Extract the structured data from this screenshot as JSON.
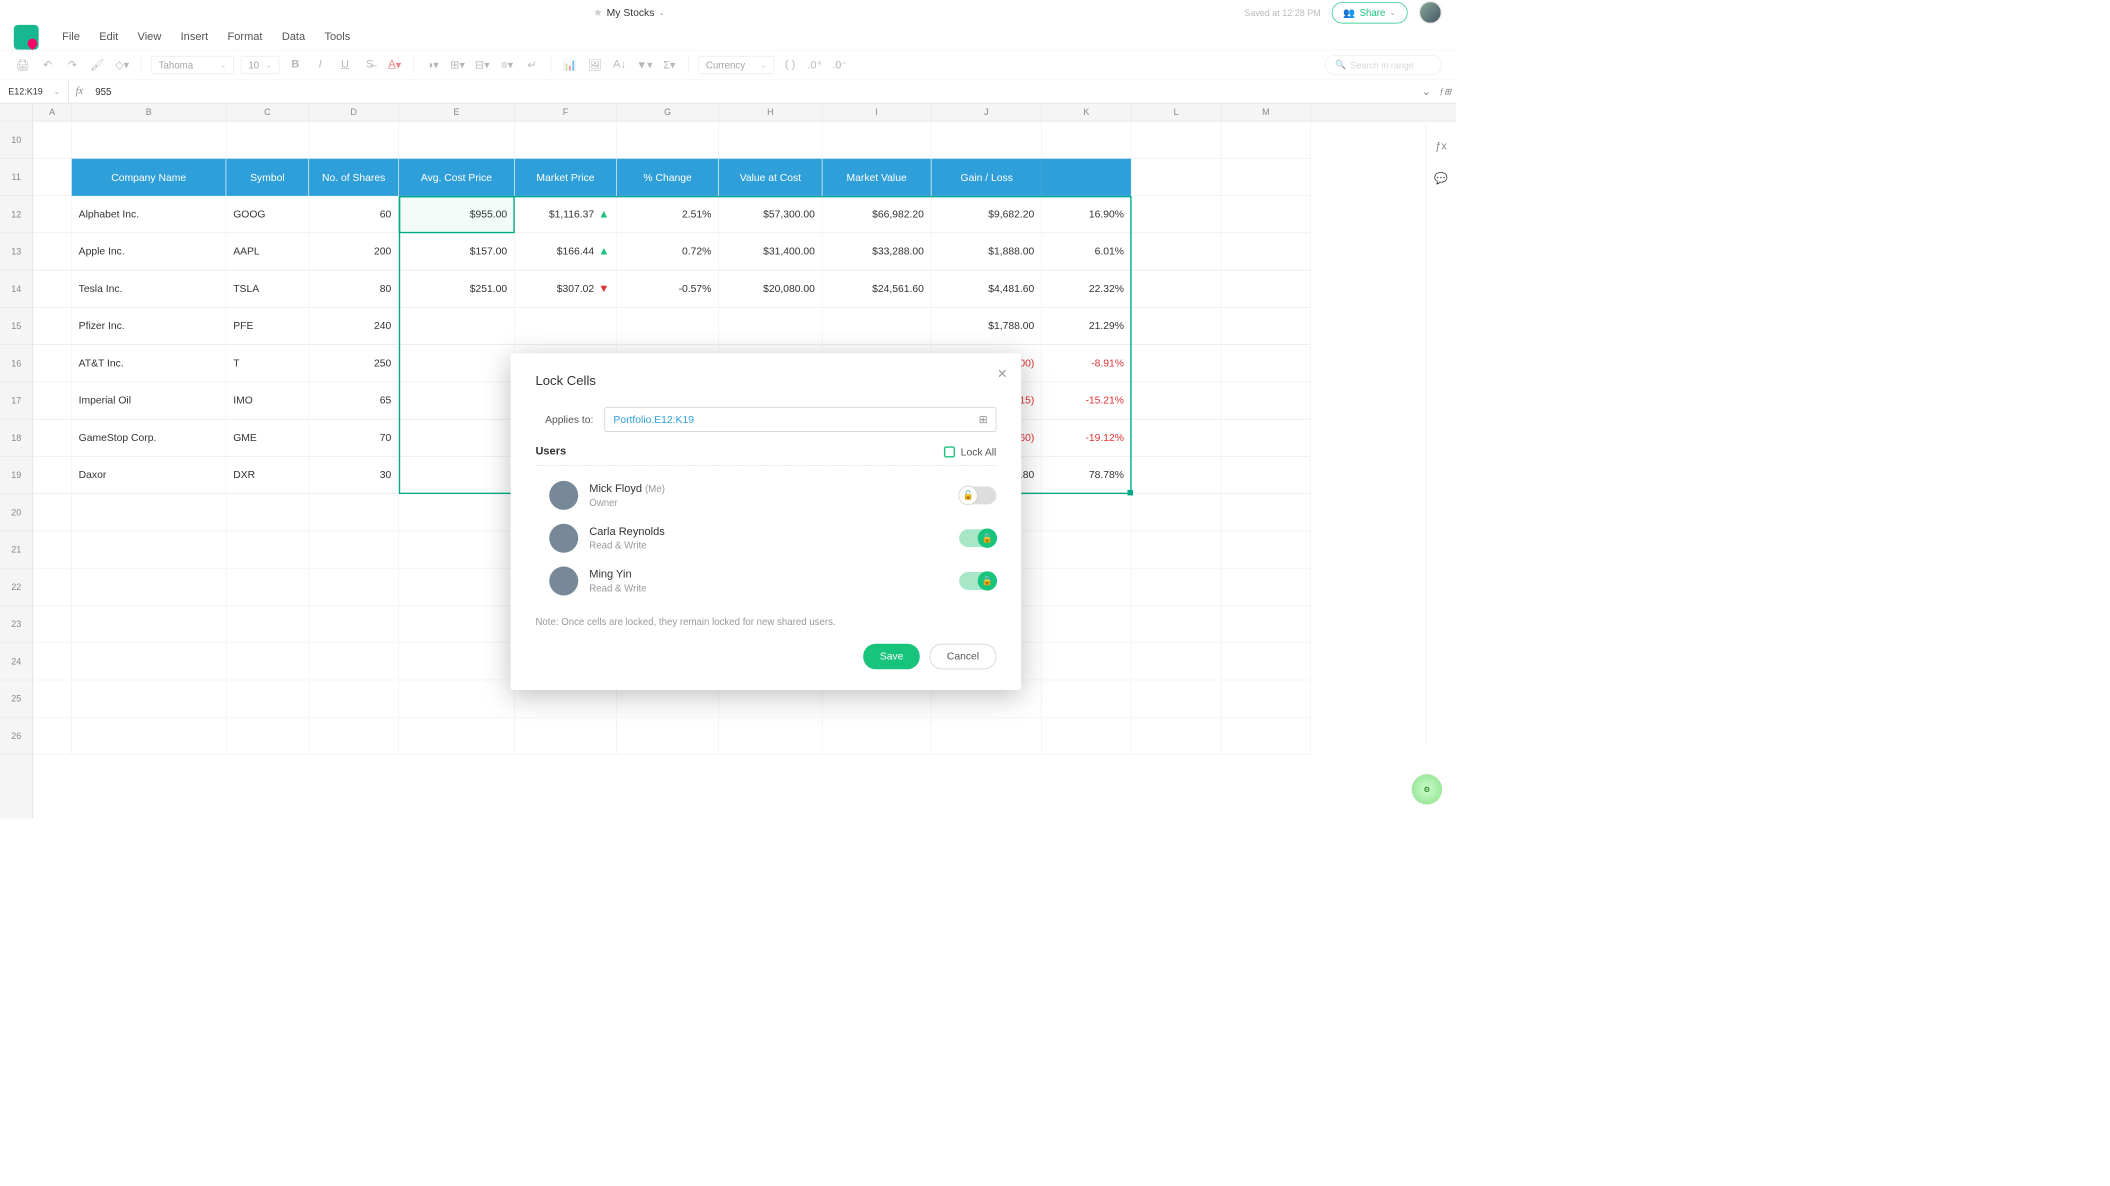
{
  "title": "My Stocks",
  "saved_text": "Saved at 12:28 PM",
  "share_label": "Share",
  "menu": [
    "File",
    "Edit",
    "View",
    "Insert",
    "Format",
    "Data",
    "Tools"
  ],
  "toolbar": {
    "font": "Tahoma",
    "size": "10",
    "format": "Currency",
    "search_placeholder": "Search in range"
  },
  "namebox": "E12:K19",
  "formula": "955",
  "columns": [
    "A",
    "B",
    "C",
    "D",
    "E",
    "F",
    "G",
    "H",
    "I",
    "J",
    "K",
    "L",
    "M"
  ],
  "row_start": 10,
  "row_end": 26,
  "table": {
    "headers": [
      "Company Name",
      "Symbol",
      "No. of Shares",
      "Avg. Cost Price",
      "Market Price",
      "% Change",
      "Value at Cost",
      "Market Value",
      "Gain / Loss",
      ""
    ],
    "gain_header_span": "Gain / Loss",
    "rows": [
      {
        "company": "Alphabet Inc.",
        "symbol": "GOOG",
        "shares": "60",
        "cost": "$955.00",
        "market": "$1,116.37",
        "dir": "up",
        "change": "2.51%",
        "vcost": "$57,300.00",
        "mval": "$66,982.20",
        "gl": "$9,682.20",
        "glp": "16.90%",
        "neg": false
      },
      {
        "company": "Apple Inc.",
        "symbol": "AAPL",
        "shares": "200",
        "cost": "$157.00",
        "market": "$166.44",
        "dir": "up",
        "change": "0.72%",
        "vcost": "$31,400.00",
        "mval": "$33,288.00",
        "gl": "$1,888.00",
        "glp": "6.01%",
        "neg": false
      },
      {
        "company": "Tesla Inc.",
        "symbol": "TSLA",
        "shares": "80",
        "cost": "$251.00",
        "market": "$307.02",
        "dir": "dn",
        "change": "-0.57%",
        "vcost": "$20,080.00",
        "mval": "$24,561.60",
        "gl": "$4,481.60",
        "glp": "22.32%",
        "neg": false
      },
      {
        "company": "Pfizer Inc.",
        "symbol": "PFE",
        "shares": "240",
        "cost": "",
        "market": "",
        "dir": "",
        "change": "",
        "vcost": "",
        "mval": "",
        "gl": "$1,788.00",
        "glp": "21.29%",
        "neg": false
      },
      {
        "company": "AT&T Inc.",
        "symbol": "T",
        "shares": "250",
        "cost": "",
        "market": "",
        "dir": "",
        "change": "",
        "vcost": "",
        "mval": "",
        "gl": "($735.00)",
        "glp": "-8.91%",
        "neg": true
      },
      {
        "company": "Imperial Oil",
        "symbol": "IMO",
        "shares": "65",
        "cost": "",
        "market": "",
        "dir": "",
        "change": "",
        "vcost": "",
        "mval": "",
        "gl": "($332.15)",
        "glp": "-15.21%",
        "neg": true
      },
      {
        "company": "GameStop Corp.",
        "symbol": "GME",
        "shares": "70",
        "cost": "",
        "market": "",
        "dir": "",
        "change": "",
        "vcost": "",
        "mval": "",
        "gl": "($187.60)",
        "glp": "-19.12%",
        "neg": true
      },
      {
        "company": "Daxor",
        "symbol": "DXR",
        "shares": "30",
        "cost": "",
        "market": "",
        "dir": "",
        "change": "",
        "vcost": "",
        "mval": "",
        "gl": "$193.80",
        "glp": "78.78%",
        "neg": false
      }
    ]
  },
  "modal": {
    "title": "Lock Cells",
    "applies_label": "Applies to:",
    "applies_value": "Portfolio.E12:K19",
    "users_label": "Users",
    "lock_all": "Lock All",
    "note": "Note:  Once cells are locked, they remain locked for new shared users.",
    "save": "Save",
    "cancel": "Cancel",
    "users": [
      {
        "name": "Mick Floyd",
        "suffix": "(Me)",
        "role": "Owner",
        "locked": false
      },
      {
        "name": "Carla Reynolds",
        "suffix": "",
        "role": "Read & Write",
        "locked": true
      },
      {
        "name": "Ming Yin",
        "suffix": "",
        "role": "Read & Write",
        "locked": true
      }
    ]
  }
}
